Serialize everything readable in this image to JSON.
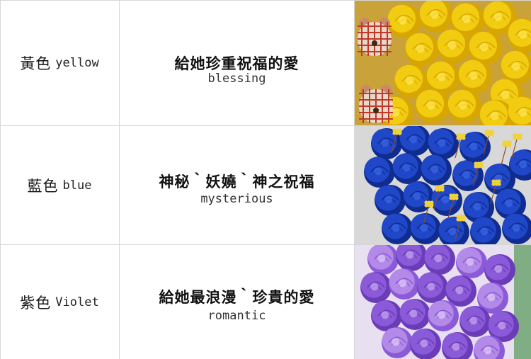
{
  "rows": [
    {
      "color_zh": "黃色",
      "color_en": "yellow",
      "meaning_zh": "給她珍重祝福的愛",
      "meaning_en": "blessing",
      "image": "yellow-roses-with-teddy-bears",
      "colors": {
        "petal": "#f2cc10",
        "petal_shade": "#d8a600",
        "petal_light": "#ffe75a",
        "leaf": "#7a8a3a",
        "bg": "#c9a23a"
      }
    },
    {
      "color_zh": "藍色",
      "color_en": "blue",
      "meaning_zh": "神秘｀妖嬈｀神之祝福",
      "meaning_en": "mysterious",
      "image": "blue-roses-with-yellow-flowers",
      "colors": {
        "petal": "#1f47c8",
        "petal_shade": "#0f2c8e",
        "petal_light": "#3a66e8",
        "accent": "#f0d23a",
        "bg": "#d8d8d8"
      }
    },
    {
      "color_zh": "紫色",
      "color_en": "Violet",
      "meaning_zh": "給她最浪漫｀珍貴的愛",
      "meaning_en": "romantic",
      "image": "violet-roses-bouquet",
      "colors": {
        "petal": "#8a5ad8",
        "petal_shade": "#6a3cb8",
        "petal_light": "#c7a8f0",
        "accent": "#3a8a3a",
        "bg": "#e8e0f0"
      }
    }
  ]
}
